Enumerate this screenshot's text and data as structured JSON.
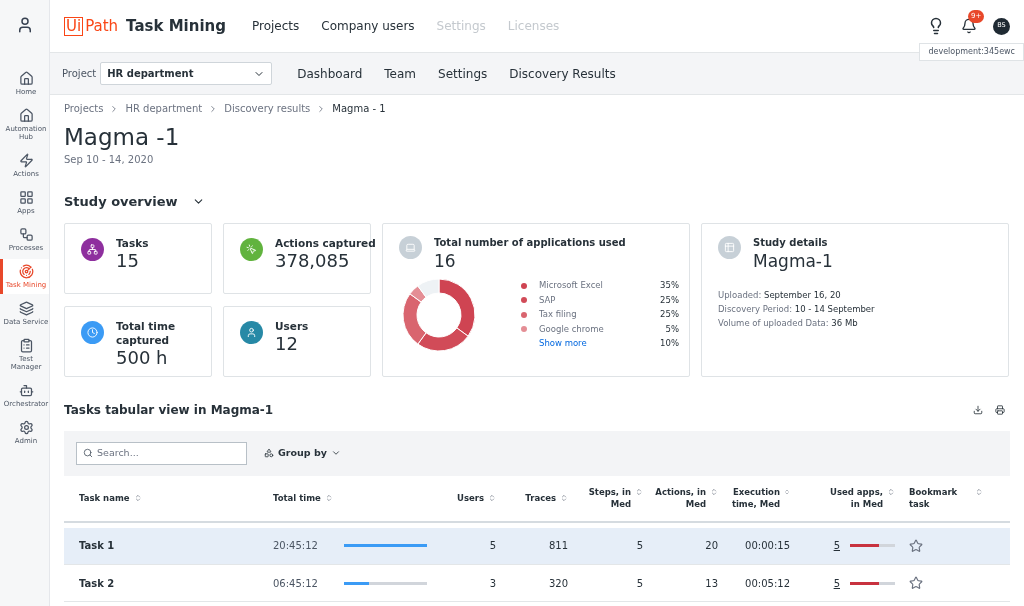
{
  "sidebar": {
    "items": [
      {
        "label": "Home",
        "selected": false
      },
      {
        "label": "Automation Hub",
        "selected": false
      },
      {
        "label": "Actions",
        "selected": false
      },
      {
        "label": "Apps",
        "selected": false
      },
      {
        "label": "Processes",
        "selected": false
      },
      {
        "label": "Task Mining",
        "selected": true
      },
      {
        "label": "Data Service",
        "selected": false
      },
      {
        "label": "Test Manager",
        "selected": false
      },
      {
        "label": "Orchestrator",
        "selected": false
      },
      {
        "label": "Admin",
        "selected": false
      }
    ]
  },
  "header": {
    "logo_mark": "Ui",
    "logo_text": "Path",
    "product": "Task Mining",
    "nav": [
      {
        "label": "Projects",
        "disabled": false
      },
      {
        "label": "Company users",
        "disabled": false
      },
      {
        "label": "Settings",
        "disabled": true
      },
      {
        "label": "Licenses",
        "disabled": true
      }
    ],
    "notification_badge": "9+",
    "avatar": "BS",
    "tooltip": "development:345ewc"
  },
  "subnav": {
    "project_label": "Project",
    "project_value": "HR department",
    "tabs": [
      {
        "label": "Dashboard",
        "selected": false
      },
      {
        "label": "Team",
        "selected": false
      },
      {
        "label": "Settings",
        "selected": false
      },
      {
        "label": "Discovery Results",
        "selected": false
      }
    ]
  },
  "breadcrumb": [
    "Projects",
    "HR department",
    "Discovery results",
    "Magma - 1"
  ],
  "title": "Magma -1",
  "date_range": "Sep 10 - 14, 2020",
  "overview": {
    "heading": "Study overview",
    "stats": [
      {
        "label": "Tasks",
        "value": "15",
        "color": "#8e2f9e"
      },
      {
        "label": "Actions captured",
        "value": "378,085",
        "color": "#61b33e"
      },
      {
        "label": "Total time captured",
        "value": "500 h",
        "color": "#3b9bf5"
      },
      {
        "label": "Users",
        "value": "12",
        "color": "#2789a6"
      }
    ],
    "applications": {
      "label": "Total number of applications used",
      "value": "16",
      "legend": [
        {
          "kind": "entry",
          "name": "Microsoft Excel",
          "value": "35%",
          "color": "#cf4452"
        },
        {
          "kind": "entry",
          "name": "SAP",
          "value": "25%",
          "color": "#d14b58"
        },
        {
          "kind": "entry",
          "name": "Tax filing",
          "value": "25%",
          "color": "#d9656f"
        },
        {
          "kind": "entry",
          "name": "Google chrome",
          "value": "5%",
          "color": "#e48e95"
        },
        {
          "kind": "link",
          "name": "Show more",
          "value": "10%"
        }
      ],
      "chart_data": {
        "type": "donut",
        "values": [
          35,
          25,
          25,
          5,
          10
        ]
      }
    },
    "details": {
      "label": "Study details",
      "value": "Magma-1",
      "lines": [
        {
          "key": "Uploaded:",
          "value": "September 16, 20"
        },
        {
          "key": "Discovery Period:",
          "value": "10 - 14 September"
        },
        {
          "key": "Volume of uploaded Data:",
          "value": "36 Mb"
        }
      ]
    }
  },
  "table": {
    "heading": "Tasks tabular view in Magma-1",
    "search_placeholder": "Search...",
    "group_by": "Group by",
    "columns": [
      "Task name",
      "Total time",
      "Users",
      "Traces",
      "Steps, in Med",
      "Actions, in Med",
      "Execution time, Med",
      "Used apps, in Med",
      "Bookmark task"
    ],
    "rows": [
      {
        "name": "Task 1",
        "total_time": "20:45:12",
        "time_bar": {
          "level": 1.0
        },
        "users": "5",
        "traces": "811",
        "steps": "5",
        "actions": "20",
        "exec": "00:00:15",
        "apps": "5",
        "apps_bar": {
          "level": 0.65
        },
        "bookmarked": false,
        "selected": true
      },
      {
        "name": "Task 2",
        "total_time": "06:45:12",
        "time_bar": {
          "level": 0.3
        },
        "users": "3",
        "traces": "320",
        "steps": "5",
        "actions": "13",
        "exec": "00:05:12",
        "apps": "5",
        "apps_bar": {
          "level": 0.65
        },
        "bookmarked": false,
        "selected": false
      }
    ]
  }
}
